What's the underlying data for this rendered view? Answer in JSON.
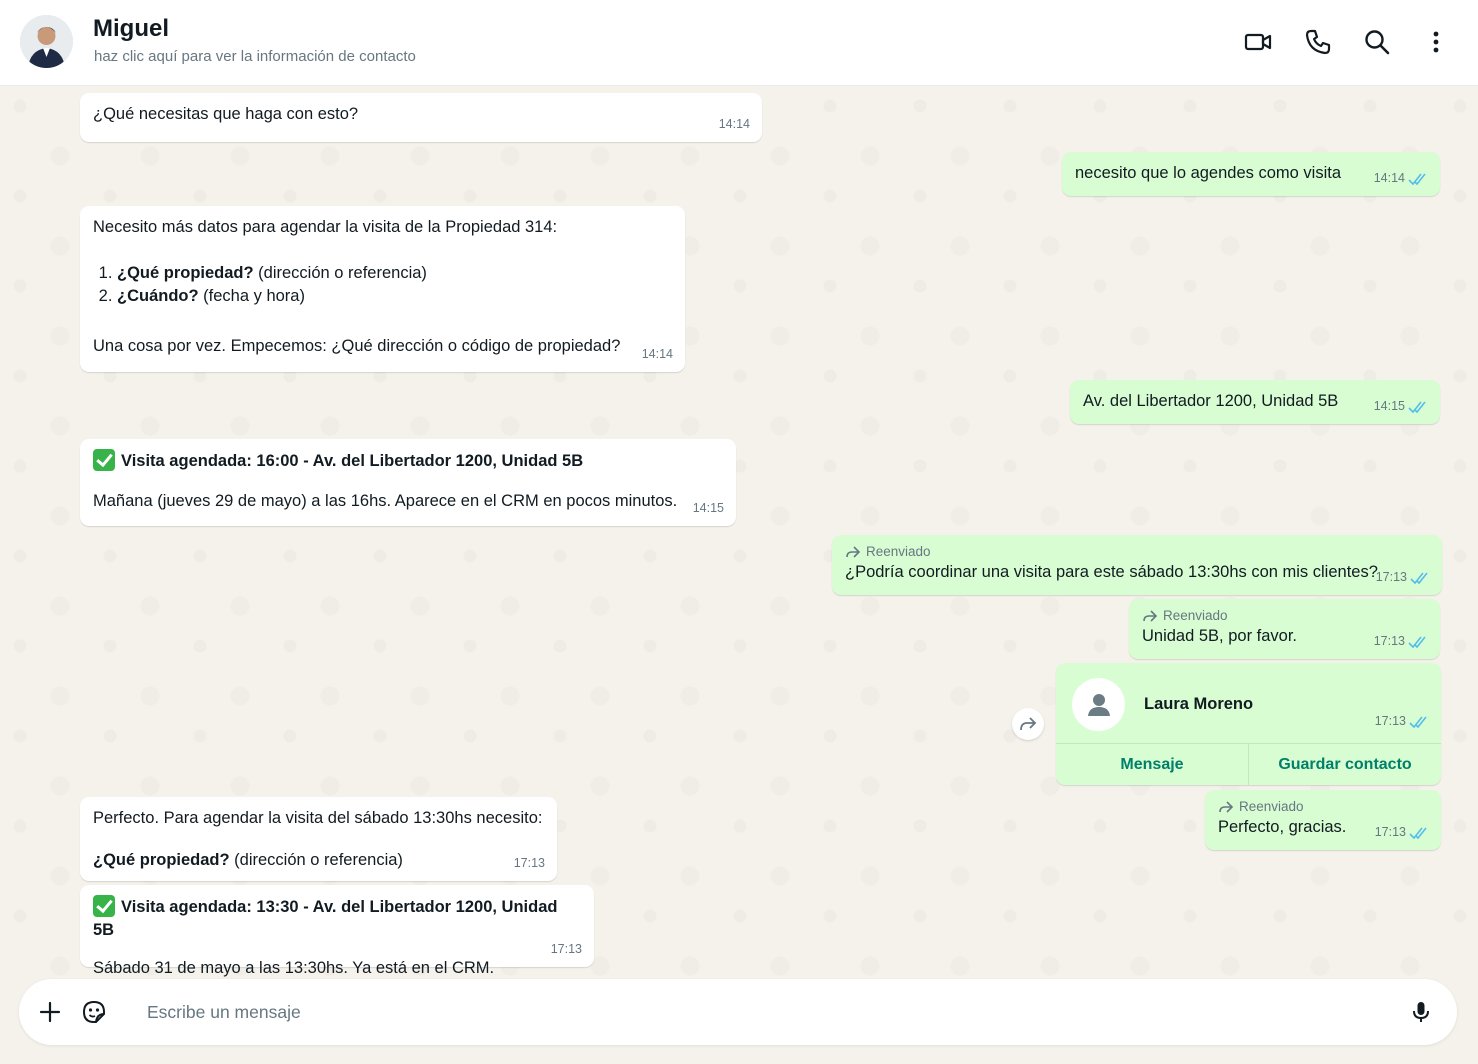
{
  "header": {
    "name": "Miguel",
    "subtitle": "haz clic aquí para ver la información de contacto"
  },
  "messages": {
    "m1": {
      "text": "¿Qué necesitas que haga con esto?",
      "time": "14:14"
    },
    "m2": {
      "text": "necesito que lo agendes como visita",
      "time": "14:14"
    },
    "m3": {
      "intro": "Necesito más datos para agendar la visita de la Propiedad 314:",
      "item1_bold": "¿Qué propiedad?",
      "item1_rest": " (dirección o referencia)",
      "item2_bold": "¿Cuándo?",
      "item2_rest": " (fecha y hora)",
      "outro": "Una cosa por vez. Empecemos: ¿Qué dirección o código de propiedad?",
      "time": "14:14"
    },
    "m4": {
      "text": "Av. del Libertador 1200, Unidad 5B",
      "time": "14:15"
    },
    "m5": {
      "title": "Visita agendada: 16:00 - Av. del Libertador 1200, Unidad 5B",
      "text": "Mañana (jueves 29 de mayo) a las 16hs. Aparece en el CRM en pocos minutos.",
      "time": "14:15"
    },
    "m6": {
      "forwarded": "Reenviado",
      "text": "¿Podría coordinar una visita para este sábado 13:30hs con mis clientes?",
      "time": "17:13"
    },
    "m7": {
      "forwarded": "Reenviado",
      "text": "Unidad 5B, por favor.",
      "time": "17:13"
    },
    "m8": {
      "contact_name": "Laura Moreno",
      "time": "17:13",
      "message_label": "Mensaje",
      "save_label": "Guardar contacto"
    },
    "m9": {
      "forwarded": "Reenviado",
      "text": "Perfecto, gracias.",
      "time": "17:13"
    },
    "m10": {
      "line1": "Perfecto. Para agendar la visita del sábado 13:30hs necesito:",
      "bold": "¿Qué propiedad?",
      "rest": " (dirección o referencia)",
      "time": "17:13"
    },
    "m11": {
      "title": "Visita agendada: 13:30 - Av. del Libertador 1200, Unidad 5B",
      "text": "Sábado 31 de mayo a las 13:30hs. Ya está en el CRM.",
      "time": "17:13"
    }
  },
  "composer": {
    "placeholder": "Escribe un mensaje"
  },
  "colors": {
    "incoming": "#ffffff",
    "outgoing": "#d9fdd3",
    "accent": "#008069",
    "ticks": "#53bdeb"
  }
}
